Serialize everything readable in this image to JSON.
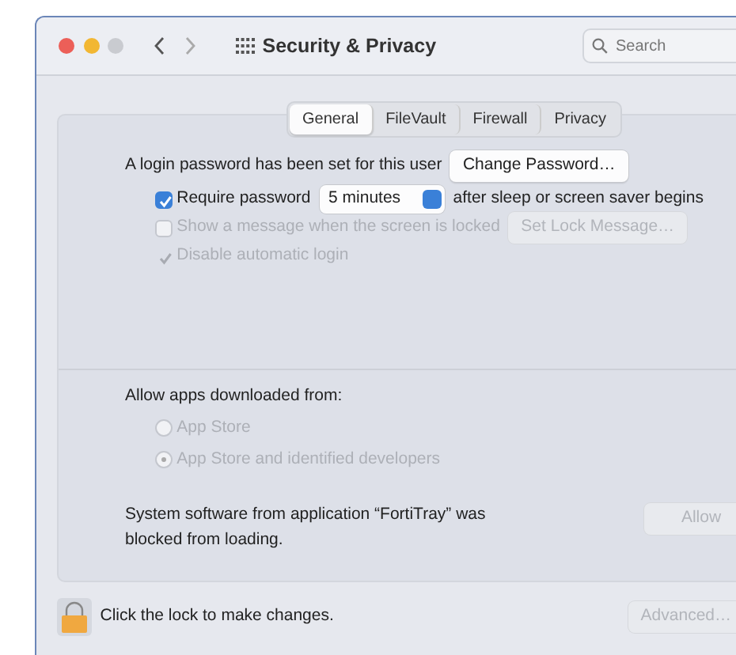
{
  "window": {
    "title": "Security & Privacy"
  },
  "search": {
    "placeholder": "Search"
  },
  "tabs": [
    {
      "label": "General",
      "selected": true
    },
    {
      "label": "FileVault",
      "selected": false
    },
    {
      "label": "Firewall",
      "selected": false
    },
    {
      "label": "Privacy",
      "selected": false
    }
  ],
  "password": {
    "text": "A login password has been set for this user",
    "button": "Change Password…"
  },
  "options": [
    {
      "kind": "checkbox-select",
      "label": "Require password",
      "checked": true,
      "disabled": false,
      "value": "5 minutes",
      "suffix": "after sleep or screen saver begins"
    },
    {
      "kind": "checkbox-button",
      "label": "Show a message when the screen is locked",
      "checked": false,
      "disabled": true,
      "button": "Set Lock Message…"
    },
    {
      "kind": "tick",
      "label": "Disable automatic login",
      "checked": true,
      "disabled": true
    }
  ],
  "downloads": {
    "heading": "Allow apps downloaded from:",
    "options": [
      {
        "label": "App Store",
        "selected": false,
        "disabled": true
      },
      {
        "label": "App Store and identified developers",
        "selected": true,
        "disabled": true
      }
    ]
  },
  "blocked": {
    "text": "System software from application “FortiTray” was blocked from loading.",
    "button": "Allow",
    "button_disabled": true
  },
  "footer": {
    "lock_text": "Click the lock to make changes.",
    "advanced": "Advanced…",
    "advanced_disabled": true
  }
}
